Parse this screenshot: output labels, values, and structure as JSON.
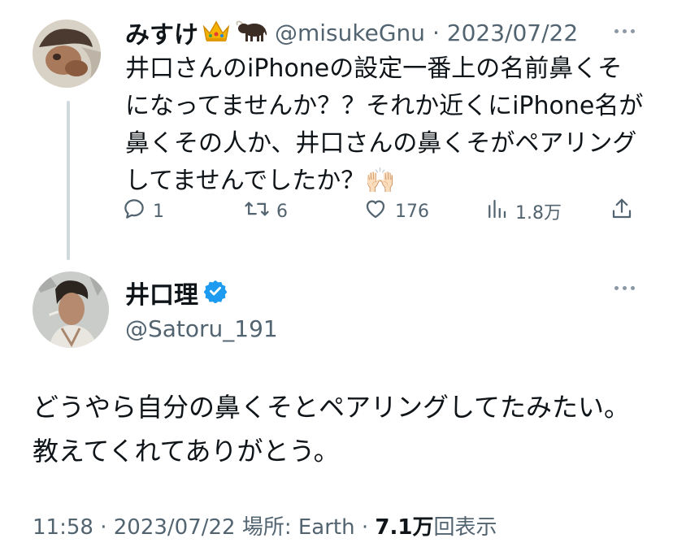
{
  "reply": {
    "display_name": "みすけ",
    "handle": "@misukeGnu",
    "separator": "·",
    "date": "2023/07/22",
    "text": "井口さんのiPhoneの設定一番上の名前鼻くそになってませんか？？それか近くにiPhone名が鼻くその人か、井口さんの鼻くそがペアリングしてませんでしたか？🙌🏻",
    "actions": {
      "replies": "1",
      "retweets": "6",
      "likes": "176",
      "views": "1.8万"
    },
    "name_emojis": [
      "crown-icon",
      "ox-icon"
    ]
  },
  "main": {
    "display_name": "井口理",
    "verified": true,
    "handle": "@Satoru_191",
    "text": "どうやら自分の鼻くそとペアリングしてたみたい。教えてくれてありがとう。",
    "meta": {
      "time": "11:58",
      "dot1": "·",
      "date": "2023/07/22",
      "location": "場所: Earth",
      "dot2": "·",
      "views_count": "7.1万",
      "views_label": "回表示"
    }
  },
  "colors": {
    "text": "#0f1419",
    "secondary": "#536471",
    "verified": "#1d9bf0",
    "thread_line": "#cfd9de"
  }
}
